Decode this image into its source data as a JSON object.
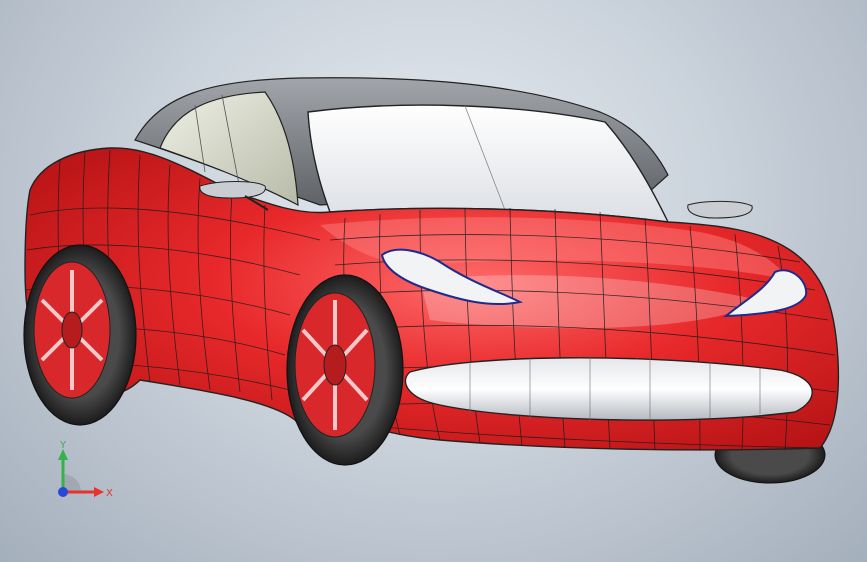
{
  "viewport": {
    "background_top": "#e6ebf0",
    "background_bottom": "#a4afbc",
    "model": {
      "name": "sports-car",
      "body_color": "#e8292b",
      "glass_color": "#d8dcc8",
      "roof_color": "#7c8086",
      "rim_color": "#d9282b",
      "tire_color": "#333333",
      "display_style": "shaded-with-edges"
    }
  },
  "triad": {
    "y_label": "Y",
    "x_label": "X",
    "y_color": "#35b24a",
    "x_color": "#e8322b",
    "z_color": "#2b47d6"
  }
}
